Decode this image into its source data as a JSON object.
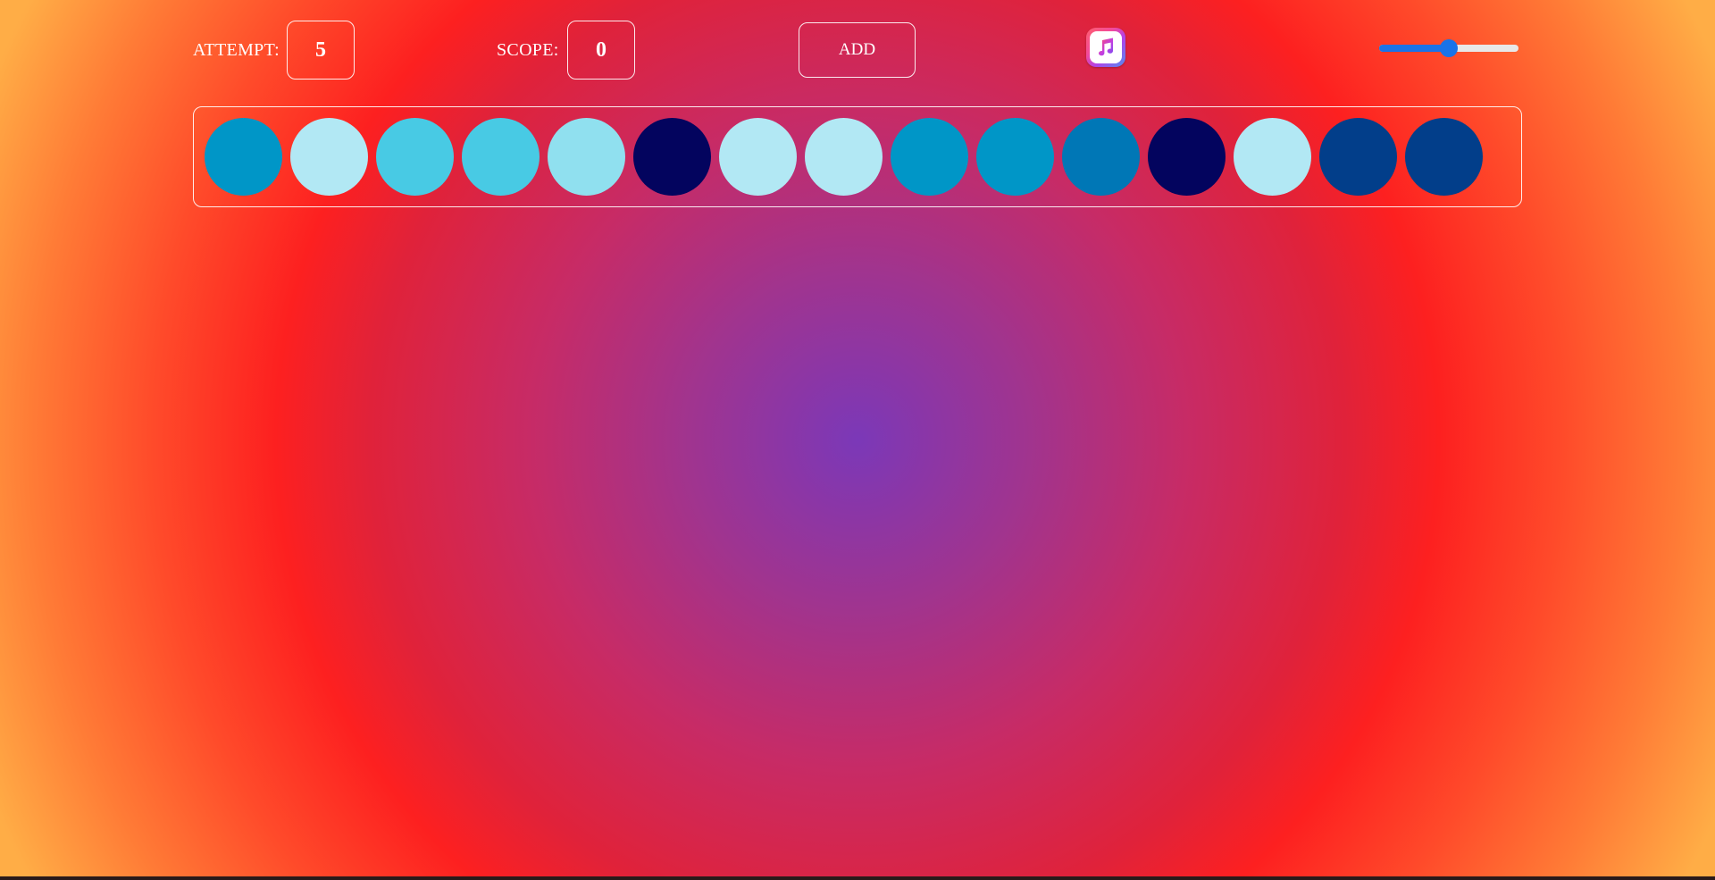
{
  "attempt": {
    "label": "ATTEMPT:",
    "value": "5"
  },
  "scope": {
    "label": "SCOPE:",
    "value": "0"
  },
  "add_button": {
    "label": "ADD"
  },
  "music_button": {
    "icon": "music-note-icon"
  },
  "volume": {
    "level": 0.5
  },
  "balls": [
    {
      "color": "#0096c7"
    },
    {
      "color": "#b2e8f4"
    },
    {
      "color": "#48cae4"
    },
    {
      "color": "#48cae4"
    },
    {
      "color": "#90e0ef"
    },
    {
      "color": "#03045e"
    },
    {
      "color": "#b2e8f4"
    },
    {
      "color": "#b2e8f4"
    },
    {
      "color": "#0096c7"
    },
    {
      "color": "#0096c7"
    },
    {
      "color": "#0077b6"
    },
    {
      "color": "#03045e"
    },
    {
      "color": "#b2e8f4"
    },
    {
      "color": "#023e8a"
    },
    {
      "color": "#023e8a"
    }
  ]
}
